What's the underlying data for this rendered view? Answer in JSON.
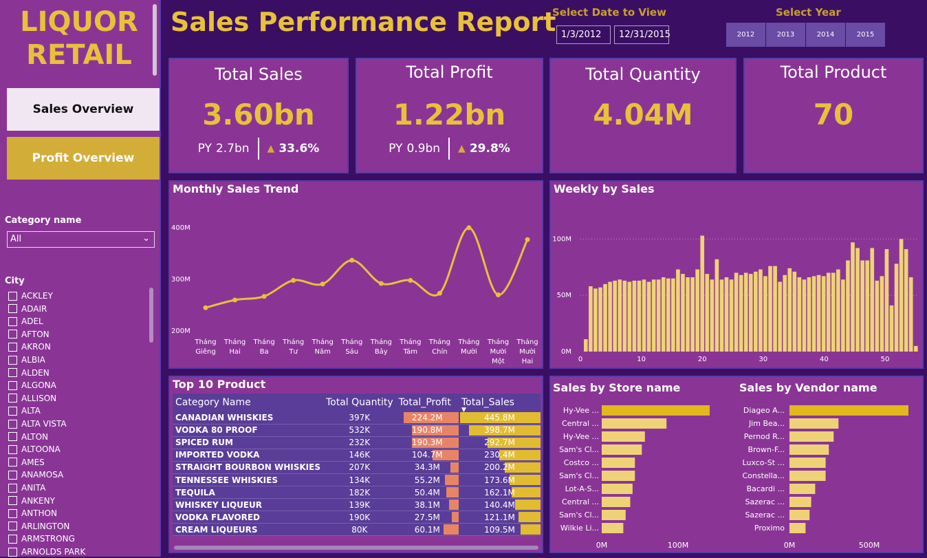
{
  "sidebar": {
    "logo_line1": "LIQUOR",
    "logo_line2": "RETAIL",
    "nav_sales": "Sales Overview",
    "nav_profit": "Profit Overview",
    "category_label": "Category name",
    "category_value": "All",
    "city_label": "City",
    "cities": [
      "ACKLEY",
      "ADAIR",
      "ADEL",
      "AFTON",
      "AKRON",
      "ALBIA",
      "ALDEN",
      "ALGONA",
      "ALLISON",
      "ALTA",
      "ALTA VISTA",
      "ALTON",
      "ALTOONA",
      "AMES",
      "ANAMOSA",
      "ANITA",
      "ANKENY",
      "ANTHON",
      "ARLINGTON",
      "ARMSTRONG",
      "ARNOLDS PARK"
    ]
  },
  "header": {
    "title": "Sales Performance Report",
    "date_label": "Select Date to View",
    "date_start": "1/3/2012",
    "date_end": "12/31/2015",
    "year_label": "Select Year",
    "years": [
      "2012",
      "2013",
      "2014",
      "2015"
    ]
  },
  "cards": {
    "sales": {
      "title": "Total Sales",
      "value": "3.60bn",
      "py_label": "PY",
      "py_value": "2.7bn",
      "growth": "33.6%"
    },
    "profit": {
      "title": "Total Profit",
      "value": "1.22bn",
      "py_label": "PY",
      "py_value": "0.9bn",
      "growth": "29.8%"
    },
    "quantity": {
      "title": "Total Quantity",
      "value": "4.04M"
    },
    "product": {
      "title": "Total Product",
      "value": "70"
    }
  },
  "monthly": {
    "title": "Monthly Sales Trend",
    "chart_data": {
      "type": "line",
      "categories": [
        [
          "Tháng",
          "Giêng"
        ],
        [
          "Tháng",
          "Hai"
        ],
        [
          "Tháng",
          "Ba"
        ],
        [
          "Tháng",
          "Tư"
        ],
        [
          "Tháng",
          "Năm"
        ],
        [
          "Tháng",
          "Sáu"
        ],
        [
          "Tháng",
          "Bảy"
        ],
        [
          "Tháng",
          "Tám"
        ],
        [
          "Tháng",
          "Chín"
        ],
        [
          "Tháng",
          "Mười"
        ],
        [
          "Tháng",
          "Mười",
          "Một"
        ],
        [
          "Tháng",
          "Mười",
          "Hai"
        ]
      ],
      "values": [
        245,
        260,
        267,
        298,
        291,
        337,
        292,
        298,
        273,
        400,
        270,
        377
      ],
      "yticks": [
        200,
        300,
        400
      ],
      "ytick_labels": [
        "200M",
        "300M",
        "400M"
      ],
      "ylim": [
        200,
        400
      ],
      "color": "#e8c13a"
    }
  },
  "weekly": {
    "title": "Weekly by Sales",
    "chart_data": {
      "type": "bar",
      "x": [
        1,
        2,
        3,
        4,
        5,
        6,
        7,
        8,
        9,
        10,
        11,
        12,
        13,
        14,
        15,
        16,
        17,
        18,
        19,
        20,
        21,
        22,
        23,
        24,
        25,
        26,
        27,
        28,
        29,
        30,
        31,
        32,
        33,
        34,
        35,
        36,
        37,
        38,
        39,
        40,
        41,
        42,
        43,
        44,
        45,
        46,
        47,
        48,
        49,
        50,
        51,
        52,
        53
      ],
      "values": [
        11,
        58,
        56,
        57,
        60,
        62,
        63,
        64,
        63,
        62,
        63,
        63,
        64,
        62,
        64,
        64,
        66,
        65,
        65,
        73,
        69,
        66,
        66,
        73,
        103,
        69,
        64,
        82,
        64,
        66,
        64,
        70,
        68,
        70,
        69,
        71,
        73,
        67,
        76,
        76,
        62,
        68,
        74,
        71,
        66,
        64,
        66,
        67,
        68,
        67,
        70,
        70,
        73,
        64,
        81,
        97,
        92,
        81,
        81,
        92,
        63,
        67,
        91,
        41,
        78,
        100,
        91,
        66,
        5
      ],
      "xticks": [
        0,
        10,
        20,
        30,
        40,
        50
      ],
      "yticks": [
        0,
        50,
        100
      ],
      "ytick_labels": [
        "0M",
        "50M",
        "100M"
      ],
      "ylim": [
        0,
        110
      ],
      "color": "#efd278"
    }
  },
  "top10": {
    "title": "Top 10 Product",
    "headers": {
      "name": "Category Name",
      "qty": "Total Quantity",
      "profit": "Total_Profit",
      "sales": "Total_Sales"
    },
    "rows": [
      {
        "name": "CANADIAN WHISKIES",
        "qty": "397K",
        "profit": "224.2M",
        "sales": "445.8M",
        "p": 224.2,
        "s": 445.8
      },
      {
        "name": "VODKA 80 PROOF",
        "qty": "532K",
        "profit": "190.8M",
        "sales": "398.7M",
        "p": 190.8,
        "s": 398.7
      },
      {
        "name": "SPICED RUM",
        "qty": "232K",
        "profit": "190.3M",
        "sales": "292.7M",
        "p": 190.3,
        "s": 292.7
      },
      {
        "name": "IMPORTED VODKA",
        "qty": "146K",
        "profit": "104.7M",
        "sales": "230.4M",
        "p": 104.7,
        "s": 230.4
      },
      {
        "name": "STRAIGHT BOURBON WHISKIES",
        "qty": "207K",
        "profit": "34.3M",
        "sales": "200.2M",
        "p": 34.3,
        "s": 200.2
      },
      {
        "name": "TENNESSEE WHISKIES",
        "qty": "134K",
        "profit": "55.2M",
        "sales": "173.6M",
        "p": 55.2,
        "s": 173.6
      },
      {
        "name": "TEQUILA",
        "qty": "182K",
        "profit": "50.4M",
        "sales": "162.1M",
        "p": 50.4,
        "s": 162.1
      },
      {
        "name": "WHISKEY LIQUEUR",
        "qty": "139K",
        "profit": "38.1M",
        "sales": "140.4M",
        "p": 38.1,
        "s": 140.4
      },
      {
        "name": "VODKA FLAVORED",
        "qty": "190K",
        "profit": "27.5M",
        "sales": "121.1M",
        "p": 27.5,
        "s": 121.1
      },
      {
        "name": "CREAM LIQUEURS",
        "qty": "80K",
        "profit": "60.1M",
        "sales": "109.5M",
        "p": 60.1,
        "s": 109.5
      }
    ],
    "profit_color": "#e88466",
    "sales_color": "#e2bc30"
  },
  "store": {
    "title": "Sales by Store name",
    "chart_data": {
      "type": "bar",
      "orientation": "horizontal",
      "categories": [
        "Hy-Vee ...",
        "Central ...",
        "Hy-Vee ...",
        "Sam's Cl...",
        "Costco ...",
        "Sam's Cl...",
        "Lot-A-S...",
        "Central ...",
        "Sam's Cl...",
        "Wilkie Li..."
      ],
      "values": [
        140,
        84,
        56,
        52,
        43,
        43,
        40,
        37,
        31,
        28
      ],
      "xticks": [
        0,
        100
      ],
      "xtick_labels": [
        "0M",
        "100M"
      ],
      "highlight_color": "#e2b81c",
      "color": "#efd278"
    }
  },
  "vendor": {
    "title": "Sales by Vendor name",
    "chart_data": {
      "type": "bar",
      "orientation": "horizontal",
      "categories": [
        "Diageo A...",
        "Jim Bea...",
        "Pernod R...",
        "Brown-F...",
        "Luxco-St ...",
        "Constella...",
        "Bacardi ...",
        "Sazerac ...",
        "Sazerac ...",
        "Proximo"
      ],
      "values": [
        740,
        305,
        275,
        245,
        225,
        225,
        160,
        135,
        125,
        100
      ],
      "xticks": [
        0,
        500
      ],
      "xtick_labels": [
        "0M",
        "500M"
      ],
      "highlight_color": "#e2b81c",
      "color": "#efd278"
    }
  }
}
